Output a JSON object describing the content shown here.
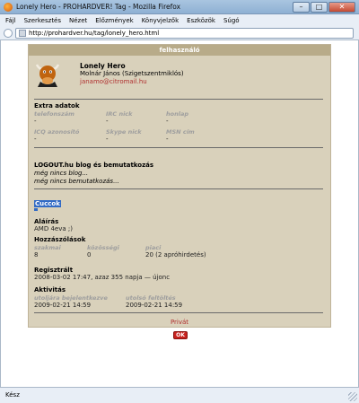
{
  "window": {
    "title": "Lonely Hero - PROHARDVER! Tag - Mozilla Firefox",
    "minimize": "–",
    "maximize": "□",
    "close": "✕"
  },
  "menu": [
    "Fájl",
    "Szerkesztés",
    "Nézet",
    "Előzmények",
    "Könyvjelzők",
    "Eszközök",
    "Súgó"
  ],
  "url": "http://prohardver.hu/tag/lonely_hero.html",
  "profile": {
    "header": "felhasználó",
    "username": "Lonely Hero",
    "realname": "Molnár János (Szigetszentmiklós)",
    "email": "janamo@citromail.hu",
    "extra": {
      "title": "Extra adatok",
      "fields": [
        {
          "label": "telefonszám",
          "value": "-"
        },
        {
          "label": "IRC nick",
          "value": "-"
        },
        {
          "label": "honlap",
          "value": "-"
        },
        {
          "label": "ICQ azonosító",
          "value": "-"
        },
        {
          "label": "Skype nick",
          "value": "-"
        },
        {
          "label": "MSN cím",
          "value": "-"
        }
      ]
    },
    "blog": {
      "title": "LOGOUT.hu blog és bemutatkozás",
      "line1": "még nincs blog...",
      "line2": "még nincs bemutatkozás..."
    },
    "cuccok": "Cuccok",
    "alairas": {
      "title": "Aláírás",
      "value": "AMD 4eva ;)"
    },
    "hozzaszolasok": {
      "title": "Hozzászólások",
      "labels": [
        "szakmai",
        "közösségi",
        "piaci"
      ],
      "values": [
        "8",
        "0",
        "20 (2 apróhirdetés)"
      ]
    },
    "regisztralt": {
      "title": "Regisztrált",
      "value": "2008-03-02 17:47, azaz 355 napja — újonc"
    },
    "aktivitas": {
      "title": "Aktivitás",
      "labels": [
        "utoljára bejelentkezve",
        "utolsó feltöltés"
      ],
      "values": [
        "2009-02-21 14:59",
        "2009-02-21 14:59"
      ]
    },
    "privat": "Privát"
  },
  "ok_button": "OK",
  "status": "Kész"
}
